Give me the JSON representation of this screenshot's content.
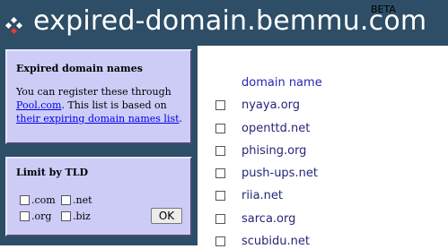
{
  "header": {
    "title": "expired-domain.bemmu.com",
    "badge": "BETA",
    "logo_icon": "diamond-dots-icon"
  },
  "sidebar": {
    "info_box": {
      "title": "Expired domain names",
      "text_before": "You can register these through ",
      "link1": "Pool.com",
      "text_middle": ". This list is based on ",
      "link2": "their expiring domain names list",
      "text_after": "."
    },
    "filter_box": {
      "title": "Limit by TLD",
      "options": [
        ".com",
        ".net",
        ".org",
        ".biz"
      ],
      "ok_label": "OK"
    }
  },
  "main": {
    "column_header": "domain name",
    "domains": [
      "nyaya.org",
      "openttd.net",
      "phising.org",
      "push-ups.net",
      "riia.net",
      "sarca.org",
      "scubidu.net"
    ]
  }
}
